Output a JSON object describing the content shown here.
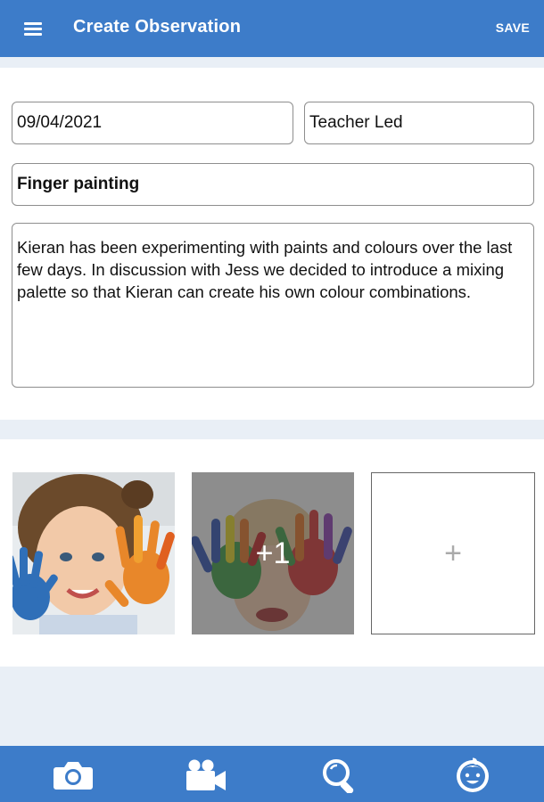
{
  "app_bar": {
    "menu_icon": "hamburger-menu-icon",
    "title": "Create Observation",
    "save_label": "SAVE"
  },
  "form": {
    "date": "09/04/2021",
    "observation_type": "Teacher Led",
    "title": "Finger painting",
    "notes": "Kieran has been experimenting with paints and colours over the last few days. In discussion with Jess we decided to introduce a mixing palette so that Kieran can create his own colour combinations."
  },
  "media": {
    "additional_count_label": "+1",
    "add_label": "+"
  },
  "bottom_nav": [
    {
      "icon": "camera-icon"
    },
    {
      "icon": "video-camera-icon"
    },
    {
      "icon": "search-icon"
    },
    {
      "icon": "child-face-icon"
    }
  ],
  "colors": {
    "primary": "#3d7cc9",
    "background": "#e9eff6",
    "card": "#ffffff"
  }
}
